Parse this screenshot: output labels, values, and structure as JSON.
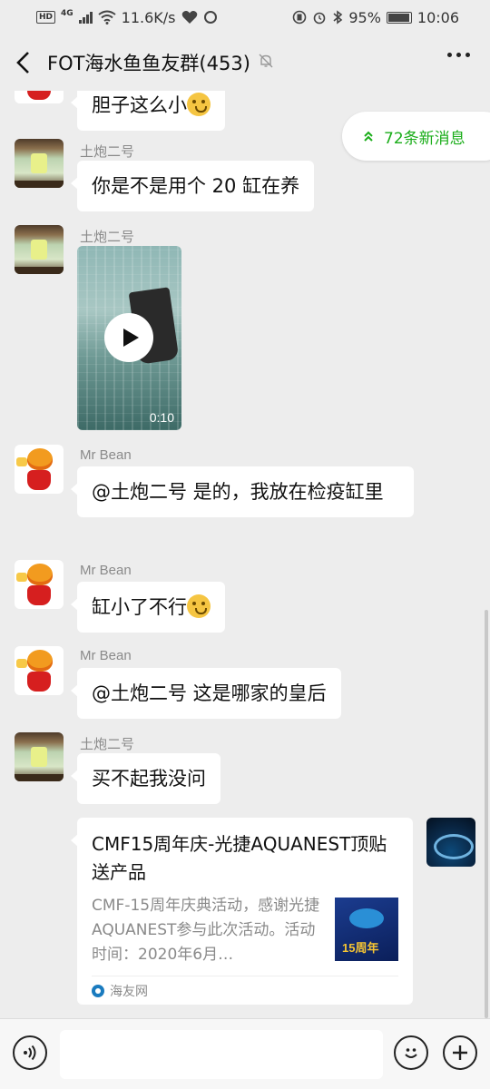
{
  "status_bar": {
    "hd": "HD",
    "net": "4G",
    "speed": "11.6K/s",
    "battery": "95%",
    "time": "10:06"
  },
  "header": {
    "title": "FOT海水鱼鱼友群(453)"
  },
  "new_messages": "72条新消息",
  "messages": [
    {
      "sender": "",
      "text": "胆子这么小"
    },
    {
      "sender": "土炮二号",
      "text": "你是不是用个 20 缸在养"
    },
    {
      "sender": "土炮二号",
      "video_duration": "0:10"
    },
    {
      "sender": "Mr Bean",
      "text": "@土炮二号  是的，我放在检疫缸里"
    },
    {
      "sender": "Mr Bean",
      "text": "缸小了不行"
    },
    {
      "sender": "Mr Bean",
      "text": "@土炮二号  这是哪家的皇后"
    },
    {
      "sender": "土炮二号",
      "text": "买不起我没问"
    }
  ],
  "link_card": {
    "title": "CMF15周年庆-光捷AQUANEST顶贴送产品",
    "description": "CMF-15周年庆典活动，感谢光捷AQUANEST参与此次活动。活动时间：2020年6月…",
    "thumb_badge": "15周年",
    "source": "海友网"
  },
  "colors": {
    "accent_green": "#1aad19",
    "background": "#ededed",
    "bubble": "#ffffff"
  }
}
